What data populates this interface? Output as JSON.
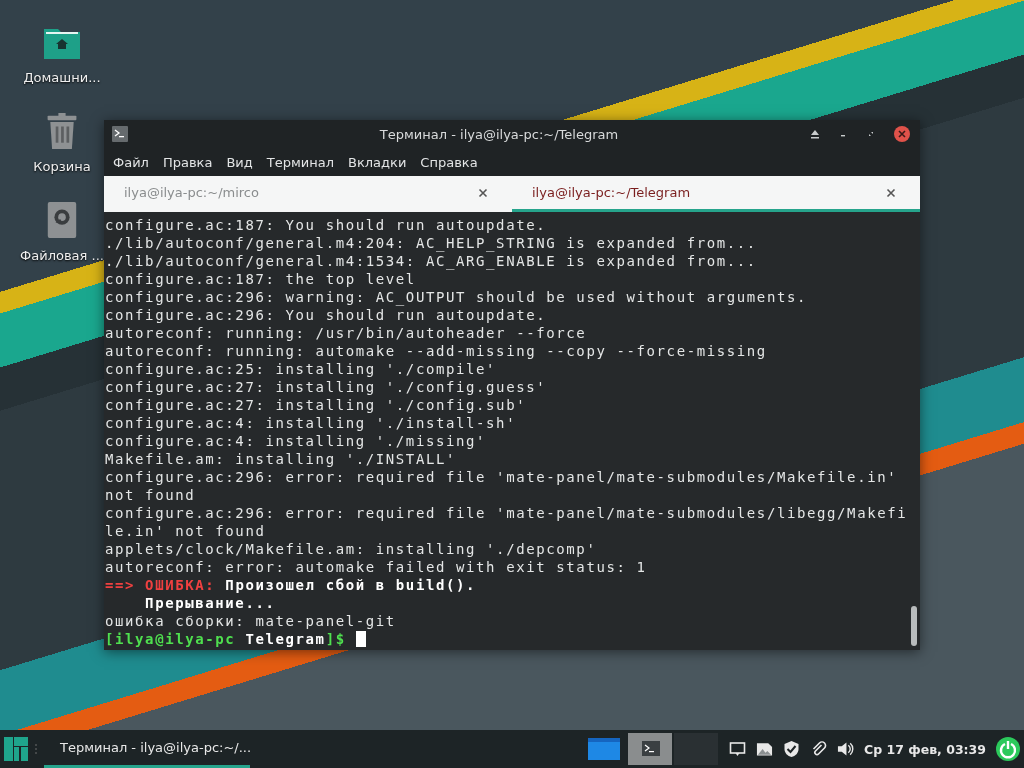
{
  "desktop_icons": [
    {
      "kind": "home",
      "label": "Домашни..."
    },
    {
      "kind": "trash",
      "label": "Корзина"
    },
    {
      "kind": "disk",
      "label": "Файловая ..."
    }
  ],
  "window": {
    "title": "Терминал - ilya@ilya-pc:~/Telegram",
    "menu": [
      "Файл",
      "Правка",
      "Вид",
      "Терминал",
      "Вкладки",
      "Справка"
    ],
    "tabs": [
      {
        "label": "ilya@ilya-pc:~/mirco",
        "selected": false
      },
      {
        "label": "ilya@ilya-pc:~/Telegram",
        "selected": true
      }
    ]
  },
  "terminal": {
    "cursor": true,
    "lines": [
      [
        {
          "kind": "plain",
          "text": "configure.ac:187: You should run autoupdate."
        }
      ],
      [
        {
          "kind": "plain",
          "text": "./lib/autoconf/general.m4:204: AC_HELP_STRING is expanded from..."
        }
      ],
      [
        {
          "kind": "plain",
          "text": "./lib/autoconf/general.m4:1534: AC_ARG_ENABLE is expanded from..."
        }
      ],
      [
        {
          "kind": "plain",
          "text": "configure.ac:187: the top level"
        }
      ],
      [
        {
          "kind": "plain",
          "text": "configure.ac:296: warning: AC_OUTPUT should be used without arguments."
        }
      ],
      [
        {
          "kind": "plain",
          "text": "configure.ac:296: You should run autoupdate."
        }
      ],
      [
        {
          "kind": "plain",
          "text": "autoreconf: running: /usr/bin/autoheader --force"
        }
      ],
      [
        {
          "kind": "plain",
          "text": "autoreconf: running: automake --add-missing --copy --force-missing"
        }
      ],
      [
        {
          "kind": "plain",
          "text": "configure.ac:25: installing './compile'"
        }
      ],
      [
        {
          "kind": "plain",
          "text": "configure.ac:27: installing './config.guess'"
        }
      ],
      [
        {
          "kind": "plain",
          "text": "configure.ac:27: installing './config.sub'"
        }
      ],
      [
        {
          "kind": "plain",
          "text": "configure.ac:4: installing './install-sh'"
        }
      ],
      [
        {
          "kind": "plain",
          "text": "configure.ac:4: installing './missing'"
        }
      ],
      [
        {
          "kind": "plain",
          "text": "Makefile.am: installing './INSTALL'"
        }
      ],
      [
        {
          "kind": "plain",
          "text": "configure.ac:296: error: required file 'mate-panel/mate-submodules/Makefile.in'"
        }
      ],
      [
        {
          "kind": "plain",
          "text": "not found"
        }
      ],
      [
        {
          "kind": "plain",
          "text": "configure.ac:296: error: required file 'mate-panel/mate-submodules/libegg/Makefi"
        }
      ],
      [
        {
          "kind": "plain",
          "text": "le.in' not found"
        }
      ],
      [
        {
          "kind": "plain",
          "text": "applets/clock/Makefile.am: installing './depcomp'"
        }
      ],
      [
        {
          "kind": "plain",
          "text": "autoreconf: error: automake failed with exit status: 1"
        }
      ],
      [
        {
          "kind": "red",
          "text": "==> ОШИБКА:"
        },
        {
          "kind": "bright",
          "text": " Произошел сбой в build()."
        }
      ],
      [
        {
          "kind": "bright",
          "text": "    Прерывание..."
        }
      ],
      [
        {
          "kind": "plain",
          "text": "ошибка сборки: mate-panel-git"
        }
      ],
      [
        {
          "kind": "green",
          "text": "[ilya@ilya-pc"
        },
        {
          "kind": "bright",
          "text": " Telegram"
        },
        {
          "kind": "green",
          "text": "]$"
        }
      ]
    ]
  },
  "taskbar": {
    "tasks": [
      {
        "label": "Терминал - ilya@ilya-pc:~/...",
        "selected": true
      }
    ],
    "workspaces": [
      {
        "kind": "window",
        "selected": false
      },
      {
        "kind": "terminal",
        "selected": true
      },
      {
        "kind": "empty",
        "selected": false
      }
    ],
    "clock": "Ср 17 фев, 03:39"
  }
}
